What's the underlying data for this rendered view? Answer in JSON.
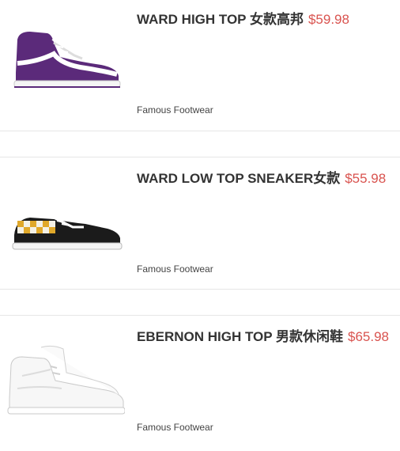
{
  "products": [
    {
      "title": "WARD HIGH TOP 女款高邦",
      "price": "$59.98",
      "store": "Famous Footwear",
      "image_icon": "purple-high-top-sneaker-icon",
      "color": "#5b2a7a"
    },
    {
      "title": "WARD LOW TOP SNEAKER女款",
      "price": "$55.98",
      "store": "Famous Footwear",
      "image_icon": "checkered-low-top-sneaker-icon",
      "color": "#e0a82a"
    },
    {
      "title": "EBERNON HIGH TOP 男款休闲鞋",
      "price": "$65.98",
      "store": "Famous Footwear",
      "image_icon": "white-high-top-sneaker-icon",
      "color": "#f2f2f2"
    }
  ],
  "price_color": "#d9534f"
}
